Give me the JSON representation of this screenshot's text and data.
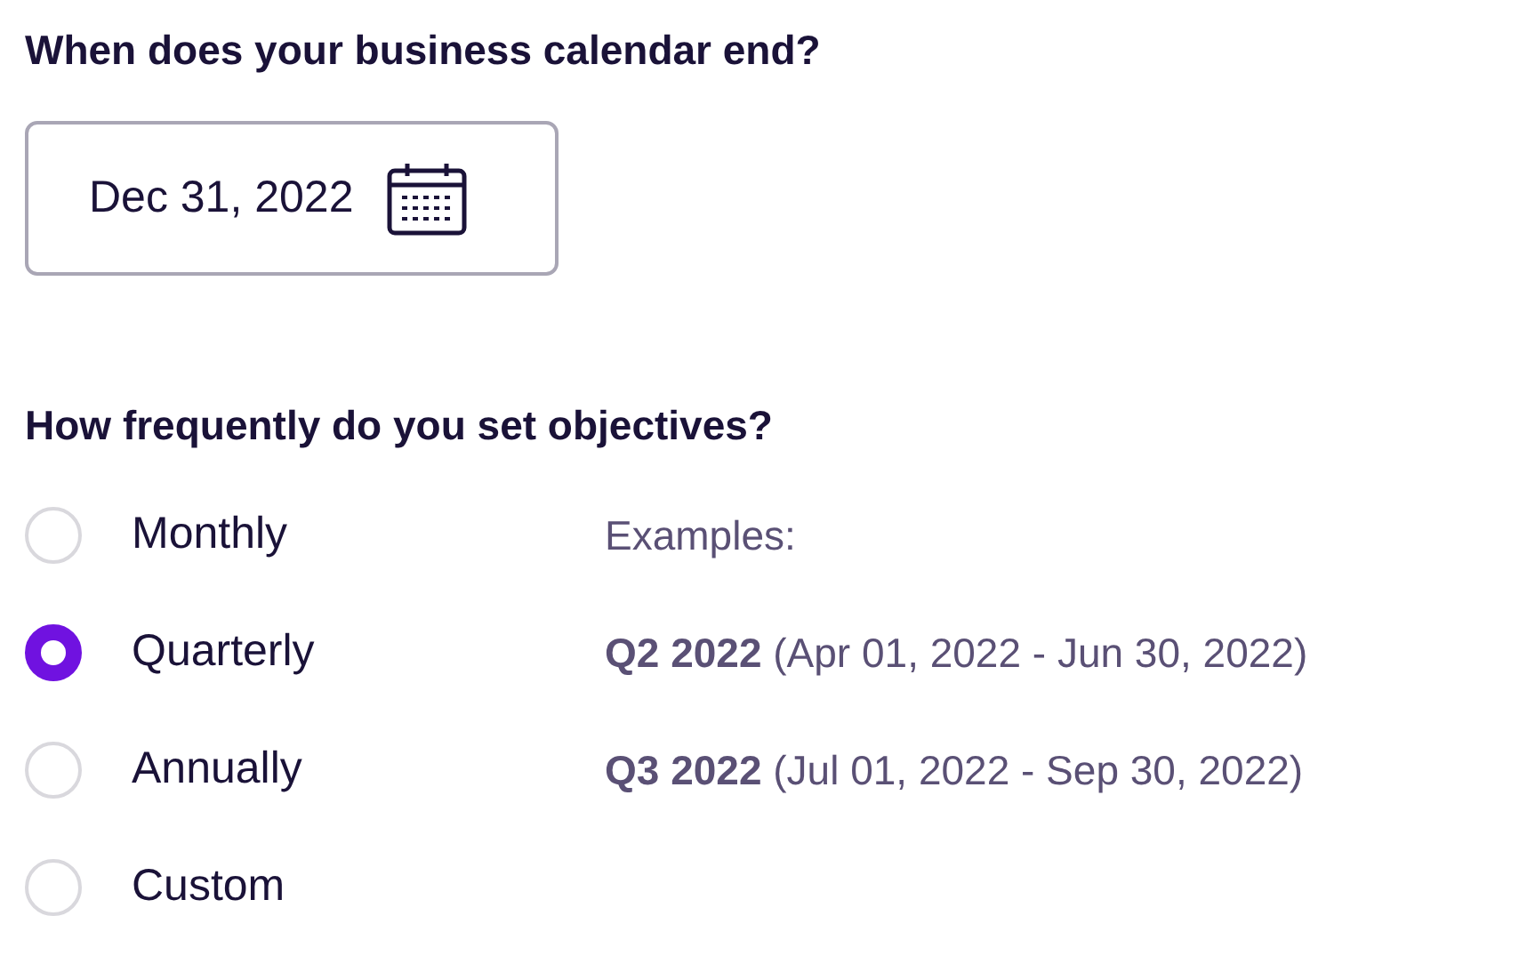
{
  "calendar_end": {
    "question": "When does your business calendar end?",
    "value": "Dec 31, 2022"
  },
  "frequency": {
    "question": "How frequently do you set objectives?",
    "options": [
      {
        "label": "Monthly",
        "selected": false
      },
      {
        "label": "Quarterly",
        "selected": true
      },
      {
        "label": "Annually",
        "selected": false
      },
      {
        "label": "Custom",
        "selected": false
      }
    ],
    "examples_label": "Examples:",
    "examples": [
      "**Q2 2022** (Apr 01, 2022 - Jun 30, 2022)",
      "**Q3 2022** (Jul 01, 2022 - Sep 30, 2022)"
    ]
  }
}
